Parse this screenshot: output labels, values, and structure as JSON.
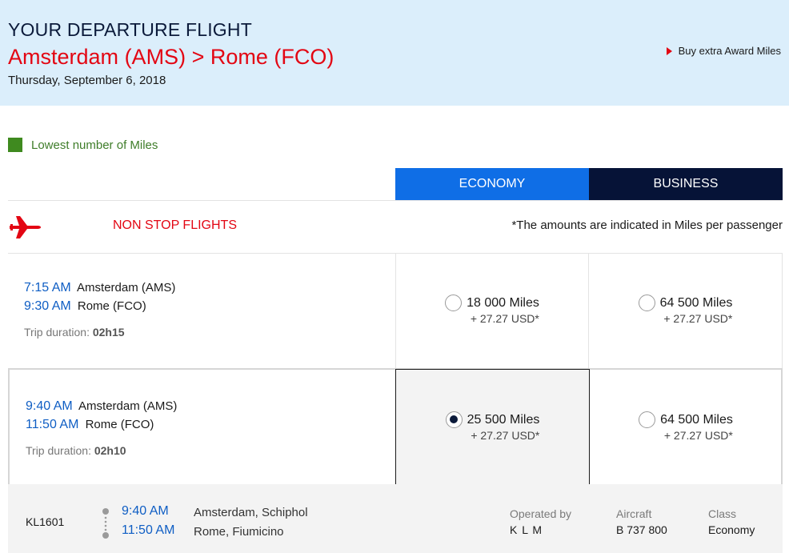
{
  "header": {
    "title": "YOUR DEPARTURE FLIGHT",
    "origin_city": "Amsterdam",
    "origin_code": "(AMS)",
    "separator": ">",
    "dest_city": "Rome",
    "dest_code": "(FCO)",
    "date": "Thursday, September 6, 2018",
    "buy_link": "Buy extra Award Miles"
  },
  "legend": {
    "label": "Lowest number of Miles",
    "color": "#3f8a1f"
  },
  "tabs": {
    "economy": "ECONOMY",
    "business": "BUSINESS"
  },
  "section": {
    "icon": "airplane-icon",
    "title": "NON STOP FLIGHTS",
    "note": "*The amounts are indicated in Miles per passenger"
  },
  "flights": [
    {
      "depart_time": "7:15 AM",
      "depart_place": "Amsterdam (AMS)",
      "arrive_time": "9:30 AM",
      "arrive_place": "Rome (FCO)",
      "duration_label": "Trip duration:",
      "duration": "02h15",
      "economy": {
        "miles": "18 000 Miles",
        "tax": "+ 27.27 USD*",
        "selected": false
      },
      "business": {
        "miles": "64 500 Miles",
        "tax": "+ 27.27 USD*",
        "selected": false
      }
    },
    {
      "depart_time": "9:40 AM",
      "depart_place": "Amsterdam (AMS)",
      "arrive_time": "11:50 AM",
      "arrive_place": "Rome (FCO)",
      "duration_label": "Trip duration:",
      "duration": "02h10",
      "economy": {
        "miles": "25 500 Miles",
        "tax": "+ 27.27 USD*",
        "selected": true
      },
      "business": {
        "miles": "64 500 Miles",
        "tax": "+ 27.27 USD*",
        "selected": false
      }
    }
  ],
  "details": {
    "flight_number": "KL1601",
    "depart_time": "9:40 AM",
    "depart_airport": "Amsterdam, Schiphol",
    "arrive_time": "11:50 AM",
    "arrive_airport": "Rome, Fiumicino",
    "operated_label": "Operated by",
    "operated_value": "K L M",
    "aircraft_label": "Aircraft",
    "aircraft_value": "B 737 800",
    "class_label": "Class",
    "class_value": "Economy"
  },
  "colors": {
    "brand_red": "#e30613",
    "header_bg": "#dbeefb",
    "economy_tab": "#0f6ee6",
    "business_tab": "#061337",
    "time_blue": "#0f5ec4"
  }
}
